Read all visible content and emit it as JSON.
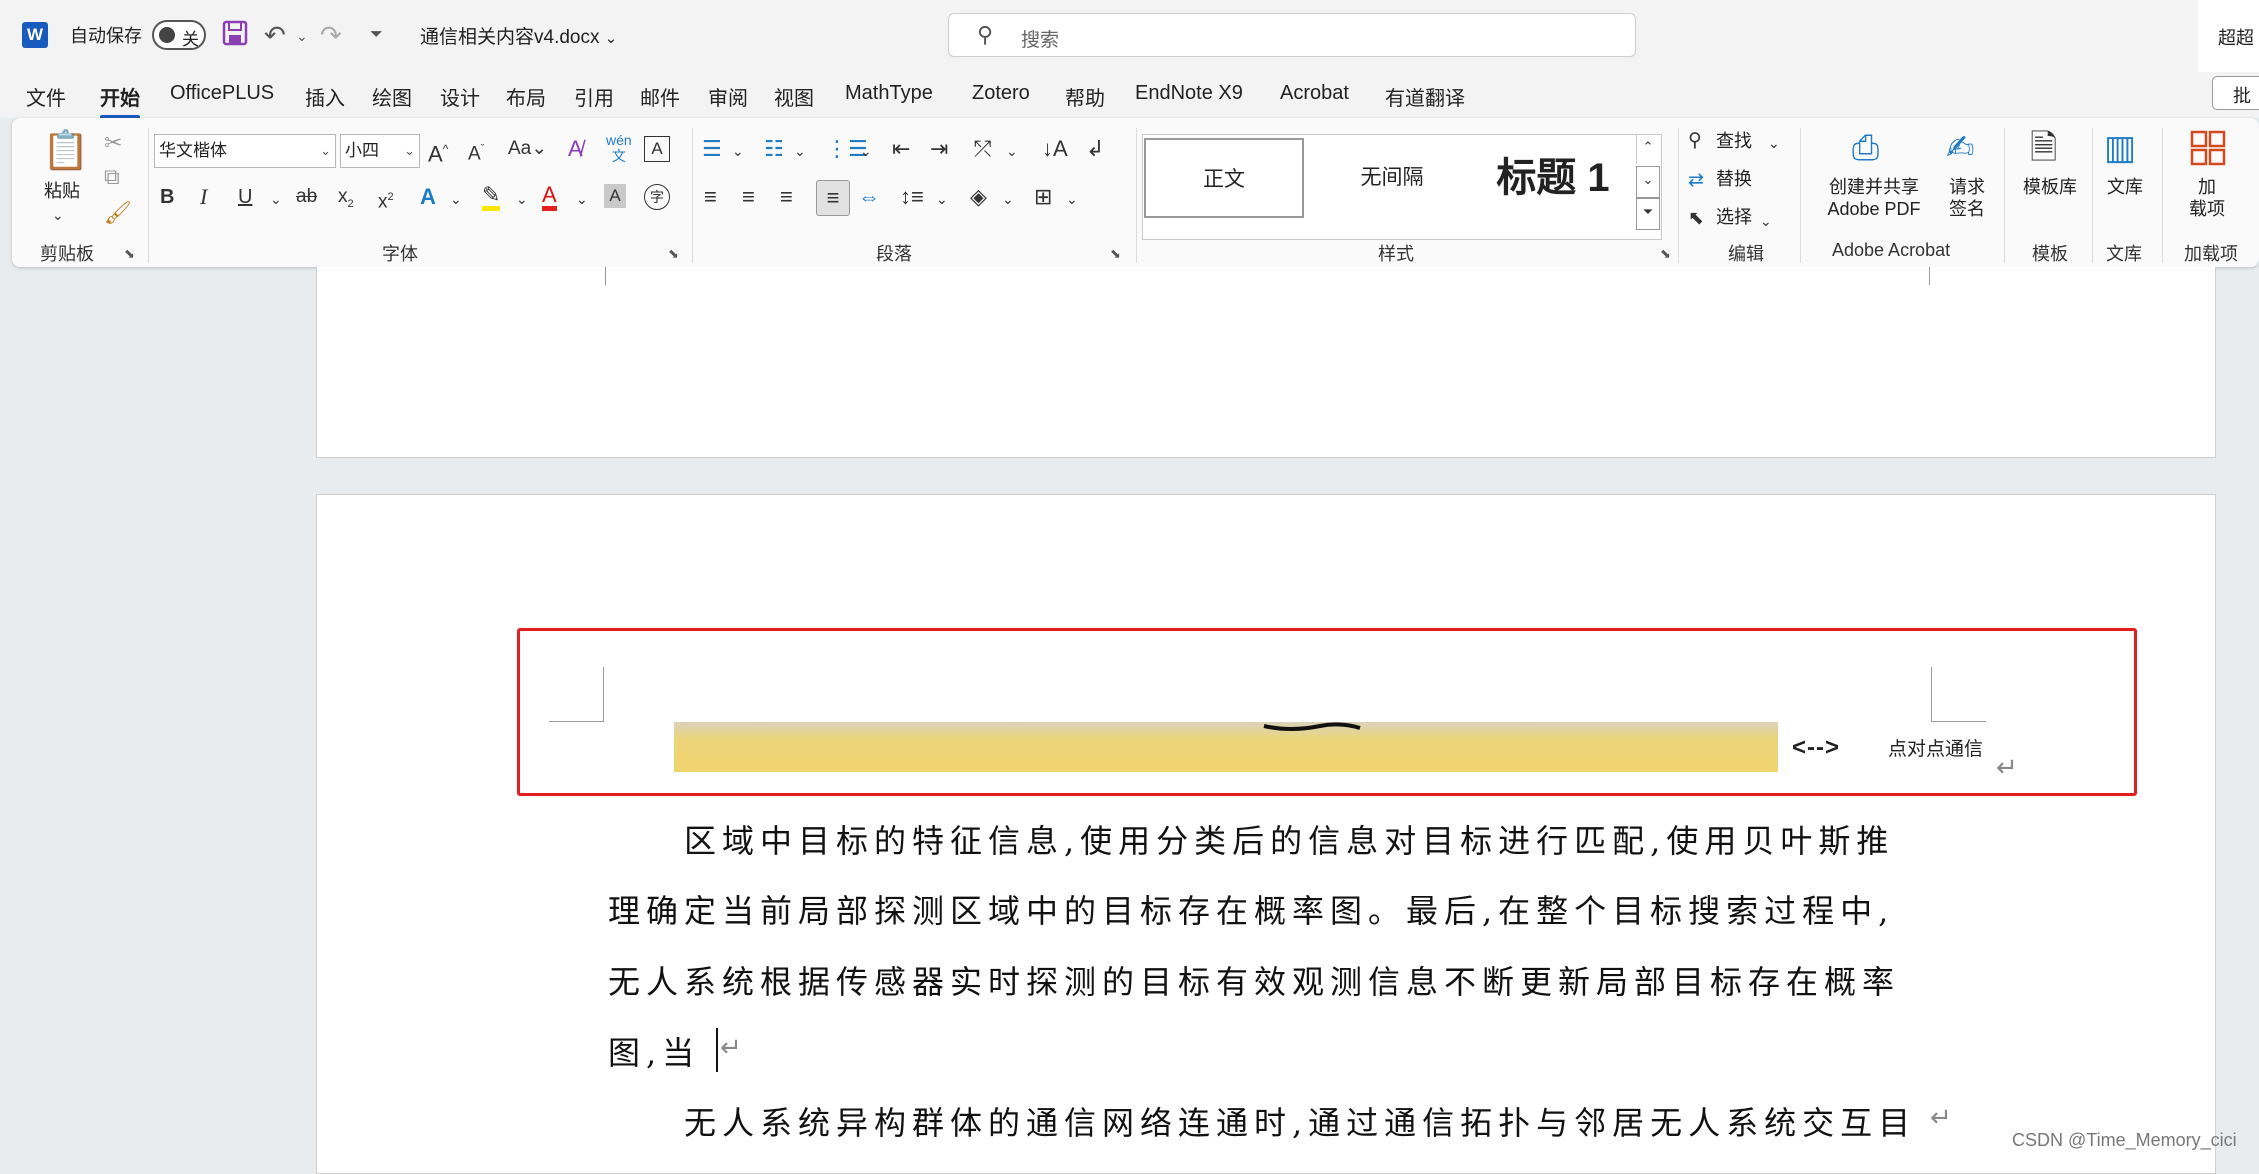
{
  "titlebar": {
    "autosave_label": "自动保存",
    "autosave_state": "关",
    "doc_title": "通信相关内容v4.docx",
    "search_placeholder": "搜索",
    "corner_label": "超超"
  },
  "menu": {
    "tabs": [
      "文件",
      "开始",
      "OfficePLUS",
      "插入",
      "绘图",
      "设计",
      "布局",
      "引用",
      "邮件",
      "审阅",
      "视图",
      "MathType",
      "Zotero",
      "帮助",
      "EndNote X9",
      "Acrobat",
      "有道翻译"
    ],
    "active": "开始",
    "share_label": "批"
  },
  "ribbon": {
    "clipboard": {
      "paste_label": "粘贴",
      "group_label": "剪贴板"
    },
    "font": {
      "font_name": "华文楷体",
      "font_size": "小四",
      "group_label": "字体"
    },
    "paragraph": {
      "group_label": "段落"
    },
    "styles": {
      "items": [
        "正文",
        "无间隔",
        "标题 1"
      ],
      "selected": "正文",
      "group_label": "样式"
    },
    "editing": {
      "find_label": "查找",
      "replace_label": "替换",
      "select_label": "选择",
      "group_label": "编辑"
    },
    "acrobat": {
      "create_label_1": "创建并共享",
      "create_label_2": "Adobe PDF",
      "sign_label_1": "请求",
      "sign_label_2": "签名",
      "group_label": "Adobe Acrobat"
    },
    "templates": {
      "label": "模板库",
      "group_label": "模板"
    },
    "library": {
      "label": "文库",
      "group_label": "文库"
    },
    "addins": {
      "label_1": "加",
      "label_2": "载项",
      "group_label": "加载项"
    }
  },
  "document": {
    "image_arrow": "<-->",
    "image_caption": "点对点通信",
    "lines": [
      "区域中目标的特征信息,使用分类后的信息对目标进行匹配,使用贝叶斯推",
      "理确定当前局部探测区域中的目标存在概率图。最后,在整个目标搜索过程中,",
      "无人系统根据传感器实时探测的目标有效观测信息不断更新局部目标存在概率",
      "图,当",
      "无人系统异构群体的通信网络连通时,通过通信拓扑与邻居无人系统交互目"
    ]
  },
  "watermark": "CSDN @Time_Memory_cici",
  "colors": {
    "accent": "#185abd",
    "highlight_box": "#e3201f"
  }
}
